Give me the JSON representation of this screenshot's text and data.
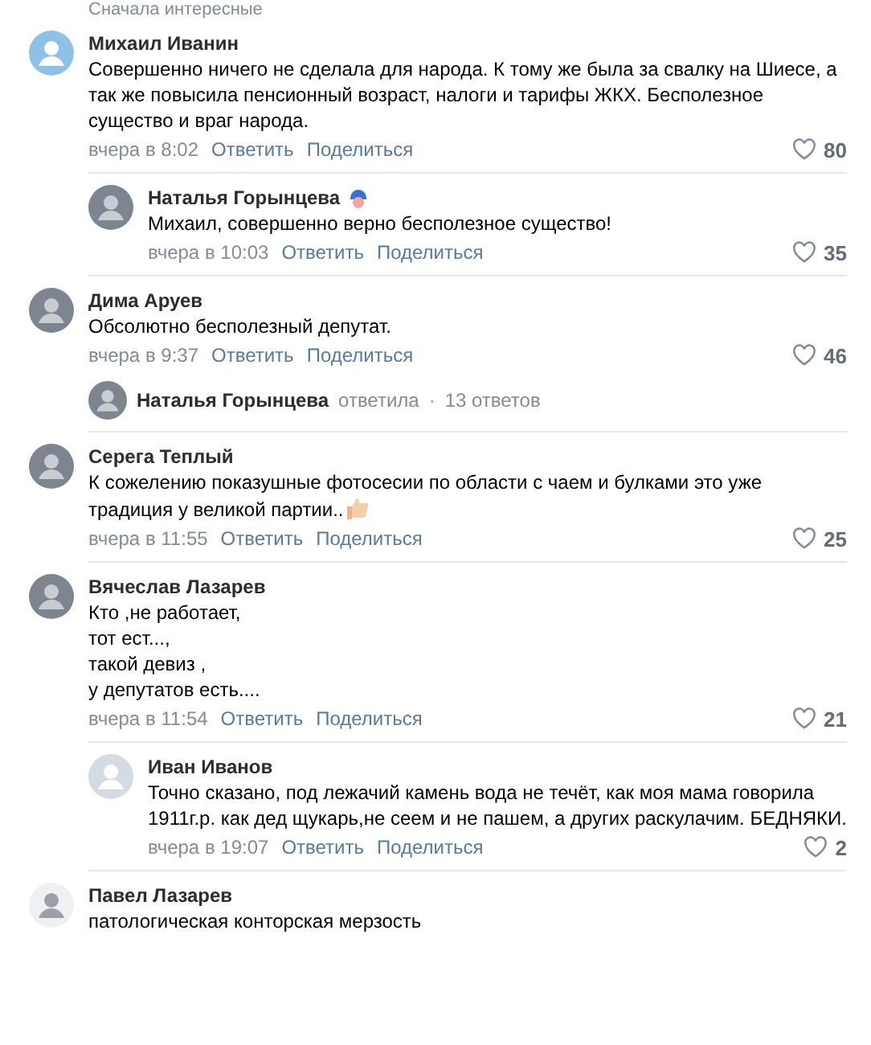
{
  "sort": {
    "label": "Сначала интересные"
  },
  "comments": [
    {
      "author": "Михаил Иванин",
      "avatar": {
        "kind": "placeholder"
      },
      "badge": false,
      "text": "Совершенно ничего не сделала для народа. К тому же была за свалку на Шиесе, а так же повысила пенсионный возраст, налоги и тарифы ЖКХ. Бесполезное существо и враг народа.",
      "time": "вчера в 8:02",
      "reply": "Ответить",
      "share": "Поделиться",
      "likes": "80",
      "replies": [
        {
          "author": "Наталья Горынцева",
          "avatar": {
            "kind": "photo"
          },
          "badge": true,
          "text": "Михаил, совершенно верно бесполезное существо!",
          "time": "вчера в 10:03",
          "reply": "Ответить",
          "share": "Поделиться",
          "likes": "35"
        }
      ]
    },
    {
      "author": "Дима Аруев",
      "avatar": {
        "kind": "photo"
      },
      "badge": false,
      "text": "Обсолютно бесполезный депутат.",
      "time": "вчера в 9:37",
      "reply": "Ответить",
      "share": "Поделиться",
      "likes": "46",
      "thread": {
        "author": "Наталья Горынцева",
        "action": "ответила",
        "separator": "·",
        "count": "13 ответов"
      }
    },
    {
      "author": "Серега Теплый",
      "avatar": {
        "kind": "photo"
      },
      "badge": false,
      "text": "К сожелению показушные фотосесии по области с чаем и булками это уже традиция у великой партии..",
      "trailing_icon": {
        "kind": "thumbs-up"
      },
      "time": "вчера в 11:55",
      "reply": "Ответить",
      "share": "Поделиться",
      "likes": "25"
    },
    {
      "author": "Вячеслав Лазарев",
      "avatar": {
        "kind": "photo"
      },
      "badge": false,
      "text": "Кто ,не работает,\nтот ест...,\nтакой девиз ,\nу депутатов есть....",
      "time": "вчера в 11:54",
      "reply": "Ответить",
      "share": "Поделиться",
      "likes": "21",
      "replies": [
        {
          "author": "Иван Иванов",
          "avatar": {
            "kind": "placeholder-grey"
          },
          "badge": false,
          "text": "Точно сказано, под лежачий камень вода не течёт, как моя мама говорила 1911г.р. как дед щукарь,не сеем и не пашем, а других раскулачим. БЕДНЯКИ.",
          "time": "вчера в 19:07",
          "reply": "Ответить",
          "share": "Поделиться",
          "likes": "2"
        }
      ]
    },
    {
      "author": "Павел Лазарев",
      "avatar": {
        "kind": "photo-light"
      },
      "badge": false,
      "text": "патологическая конторская мерзость"
    }
  ]
}
